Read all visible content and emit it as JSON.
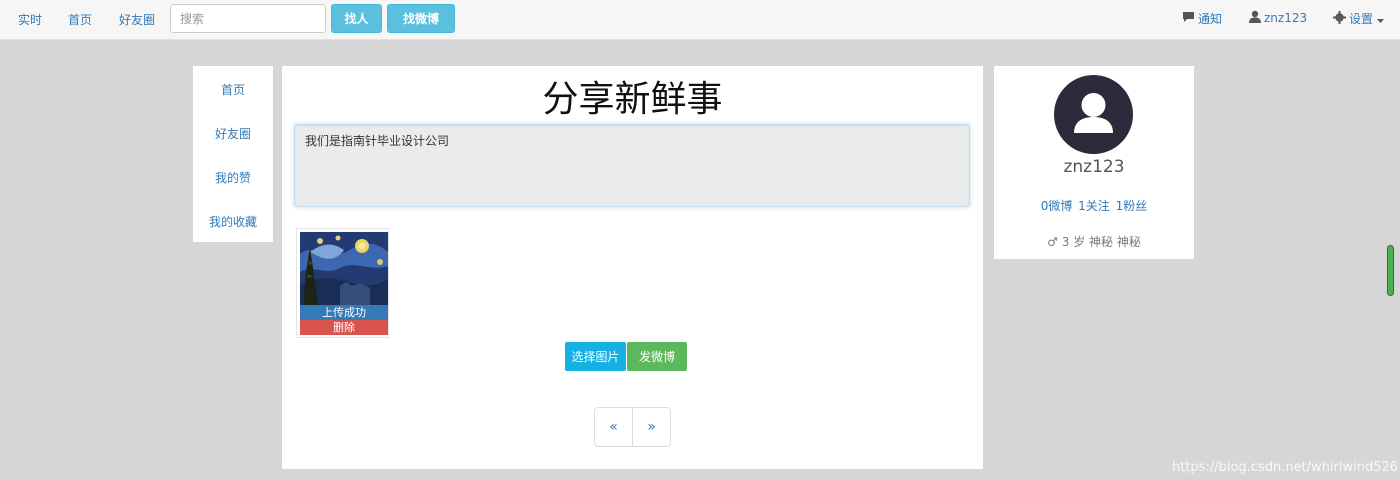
{
  "nav": {
    "links": [
      "实时",
      "首页",
      "好友圈"
    ],
    "search_placeholder": "搜索",
    "btn_find_people": "找人",
    "btn_find_weibo": "找微博",
    "notify": "通知",
    "user": "znz123",
    "settings": "设置"
  },
  "left_menu": {
    "items": [
      "首页",
      "好友圈",
      "我的赞",
      "我的收藏"
    ]
  },
  "main": {
    "title": "分享新鲜事",
    "post_text": "我们是指南针毕业设计公司",
    "upload_status": "上传成功",
    "delete_label": "删除",
    "btn_select_image": "选择图片",
    "btn_post": "发微博",
    "pager_prev": "«",
    "pager_next": "»"
  },
  "profile": {
    "username": "znz123",
    "weibo_count": "0微博",
    "follow_count": "1关注",
    "fans_count": "1粉丝",
    "info": "♂ 3 岁 神秘 神秘"
  },
  "watermark": "https://blog.csdn.net/whirlwind526",
  "colors": {
    "link": "#337ab7",
    "nav_button": "#5bc0de",
    "select_button": "#16b1e3",
    "post_button": "#5cb85c",
    "delete": "#d9534f"
  }
}
